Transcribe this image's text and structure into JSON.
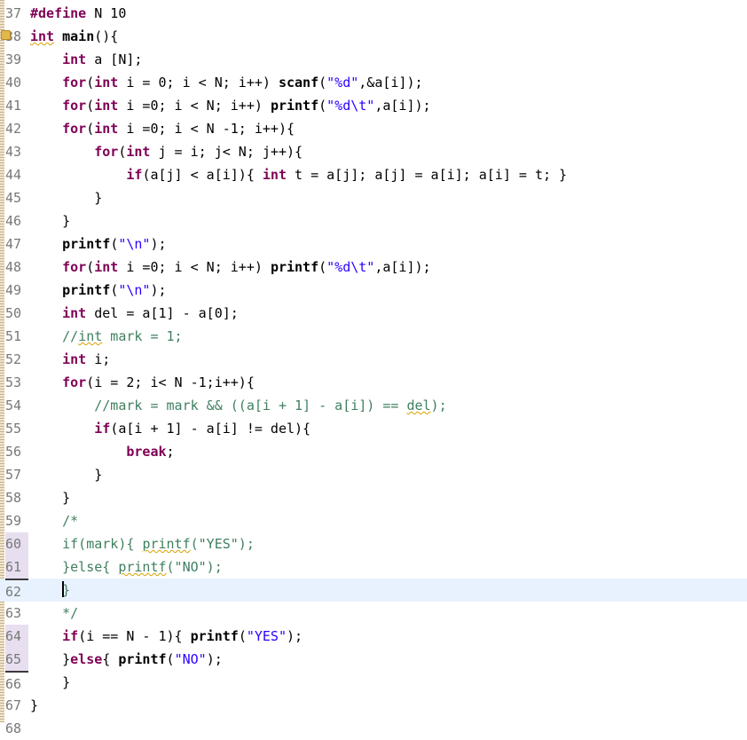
{
  "editor": {
    "lines": [
      {
        "num": "37",
        "tokens": [
          [
            "kw",
            "#define"
          ],
          [
            "",
            " N 10"
          ]
        ]
      },
      {
        "num": "38",
        "marker": true,
        "tokens": [
          [
            "kw sq",
            "int"
          ],
          [
            "",
            " "
          ],
          [
            "fn",
            "main"
          ],
          [
            "",
            "(){"
          ]
        ]
      },
      {
        "num": "39",
        "tokens": [
          [
            "",
            "    "
          ],
          [
            "kw",
            "int"
          ],
          [
            "",
            " a [N];"
          ]
        ]
      },
      {
        "num": "40",
        "tokens": [
          [
            "",
            "    "
          ],
          [
            "kw",
            "for"
          ],
          [
            "",
            "("
          ],
          [
            "kw",
            "int"
          ],
          [
            "",
            " i = 0; i < N; i++) "
          ],
          [
            "fn",
            "scanf"
          ],
          [
            "",
            "("
          ],
          [
            "str",
            "\"%d\""
          ],
          [
            "",
            ",&a[i]);"
          ]
        ]
      },
      {
        "num": "41",
        "tokens": [
          [
            "",
            "    "
          ],
          [
            "kw",
            "for"
          ],
          [
            "",
            "("
          ],
          [
            "kw",
            "int"
          ],
          [
            "",
            " i =0; i < N; i++) "
          ],
          [
            "fn",
            "printf"
          ],
          [
            "",
            "("
          ],
          [
            "str",
            "\"%d\\t\""
          ],
          [
            "",
            ",a[i]);"
          ]
        ]
      },
      {
        "num": "42",
        "tokens": [
          [
            "",
            "    "
          ],
          [
            "kw",
            "for"
          ],
          [
            "",
            "("
          ],
          [
            "kw",
            "int"
          ],
          [
            "",
            " i =0; i < N -1; i++){"
          ]
        ]
      },
      {
        "num": "43",
        "tokens": [
          [
            "",
            "        "
          ],
          [
            "kw",
            "for"
          ],
          [
            "",
            "("
          ],
          [
            "kw",
            "int"
          ],
          [
            "",
            " j = i; j< N; j++){"
          ]
        ]
      },
      {
        "num": "44",
        "tokens": [
          [
            "",
            "            "
          ],
          [
            "kw",
            "if"
          ],
          [
            "",
            "(a[j] < a[i]){ "
          ],
          [
            "kw",
            "int"
          ],
          [
            "",
            " t = a[j]; a[j] = a[i]; a[i] = t; }"
          ]
        ]
      },
      {
        "num": "45",
        "tokens": [
          [
            "",
            "        }"
          ]
        ]
      },
      {
        "num": "46",
        "tokens": [
          [
            "",
            "    }"
          ]
        ]
      },
      {
        "num": "47",
        "tokens": [
          [
            "",
            "    "
          ],
          [
            "fn",
            "printf"
          ],
          [
            "",
            "("
          ],
          [
            "str",
            "\"\\n\""
          ],
          [
            "",
            ");"
          ]
        ]
      },
      {
        "num": "48",
        "tokens": [
          [
            "",
            "    "
          ],
          [
            "kw",
            "for"
          ],
          [
            "",
            "("
          ],
          [
            "kw",
            "int"
          ],
          [
            "",
            " i =0; i < N; i++) "
          ],
          [
            "fn",
            "printf"
          ],
          [
            "",
            "("
          ],
          [
            "str",
            "\"%d\\t\""
          ],
          [
            "",
            ",a[i]);"
          ]
        ]
      },
      {
        "num": "49",
        "tokens": [
          [
            "",
            "    "
          ],
          [
            "fn",
            "printf"
          ],
          [
            "",
            "("
          ],
          [
            "str",
            "\"\\n\""
          ],
          [
            "",
            ");"
          ]
        ]
      },
      {
        "num": "50",
        "tokens": [
          [
            "",
            "    "
          ],
          [
            "kw",
            "int"
          ],
          [
            "",
            " del = a[1] - a[0];"
          ]
        ]
      },
      {
        "num": "51",
        "tokens": [
          [
            "",
            "    "
          ],
          [
            "cm",
            "//"
          ],
          [
            "cm sq",
            "int"
          ],
          [
            "cm",
            " mark = 1;"
          ]
        ]
      },
      {
        "num": "52",
        "tokens": [
          [
            "",
            "    "
          ],
          [
            "kw",
            "int"
          ],
          [
            "",
            " i;"
          ]
        ]
      },
      {
        "num": "53",
        "tokens": [
          [
            "",
            "    "
          ],
          [
            "kw",
            "for"
          ],
          [
            "",
            "(i = 2; i< N -1;i++){"
          ]
        ]
      },
      {
        "num": "54",
        "tokens": [
          [
            "",
            "        "
          ],
          [
            "cm",
            "//mark = mark && ((a[i + 1] - a[i]) == "
          ],
          [
            "cm sq",
            "del"
          ],
          [
            "cm",
            ");"
          ]
        ]
      },
      {
        "num": "55",
        "tokens": [
          [
            "",
            "        "
          ],
          [
            "kw",
            "if"
          ],
          [
            "",
            "(a[i + 1] - a[i] != del){"
          ]
        ]
      },
      {
        "num": "56",
        "tokens": [
          [
            "",
            "            "
          ],
          [
            "kw",
            "break"
          ],
          [
            "",
            ";"
          ]
        ]
      },
      {
        "num": "57",
        "tokens": [
          [
            "",
            "        }"
          ]
        ]
      },
      {
        "num": "58",
        "tokens": [
          [
            "",
            "    }"
          ]
        ]
      },
      {
        "num": "59",
        "tokens": [
          [
            "",
            "    "
          ],
          [
            "cm",
            "/*"
          ]
        ]
      },
      {
        "num": "60",
        "changed": true,
        "tokens": [
          [
            "",
            "    "
          ],
          [
            "cm",
            "if(mark){ "
          ],
          [
            "cm sq",
            "printf"
          ],
          [
            "cm",
            "(\"YES\");"
          ]
        ]
      },
      {
        "num": "61",
        "changed": true,
        "tokens": [
          [
            "",
            "    "
          ],
          [
            "cm",
            "}else{ "
          ],
          [
            "cm sq",
            "printf"
          ],
          [
            "cm",
            "(\"NO\");"
          ]
        ]
      },
      {
        "num": "62",
        "changed": true,
        "deletedBar": true,
        "current": true,
        "caretBefore": true,
        "tokens": [
          [
            "",
            "    "
          ],
          [
            "cm",
            "}"
          ]
        ]
      },
      {
        "num": "63",
        "tokens": [
          [
            "",
            "    "
          ],
          [
            "cm",
            "*/"
          ]
        ]
      },
      {
        "num": "64",
        "changed": true,
        "tokens": [
          [
            "",
            "    "
          ],
          [
            "kw",
            "if"
          ],
          [
            "",
            "(i == N - 1){ "
          ],
          [
            "fn",
            "printf"
          ],
          [
            "",
            "("
          ],
          [
            "str",
            "\"YES\""
          ],
          [
            "",
            ");"
          ]
        ]
      },
      {
        "num": "65",
        "changed": true,
        "tokens": [
          [
            "",
            "    }"
          ],
          [
            "kw",
            "else"
          ],
          [
            "",
            "{ "
          ],
          [
            "fn",
            "printf"
          ],
          [
            "",
            "("
          ],
          [
            "str",
            "\"NO\""
          ],
          [
            "",
            ");"
          ]
        ]
      },
      {
        "num": "66",
        "deletedBar": true,
        "tokens": [
          [
            "",
            "    }"
          ]
        ]
      },
      {
        "num": "67",
        "tokens": [
          [
            "",
            "}"
          ]
        ]
      },
      {
        "num": "68",
        "tokens": []
      }
    ]
  }
}
